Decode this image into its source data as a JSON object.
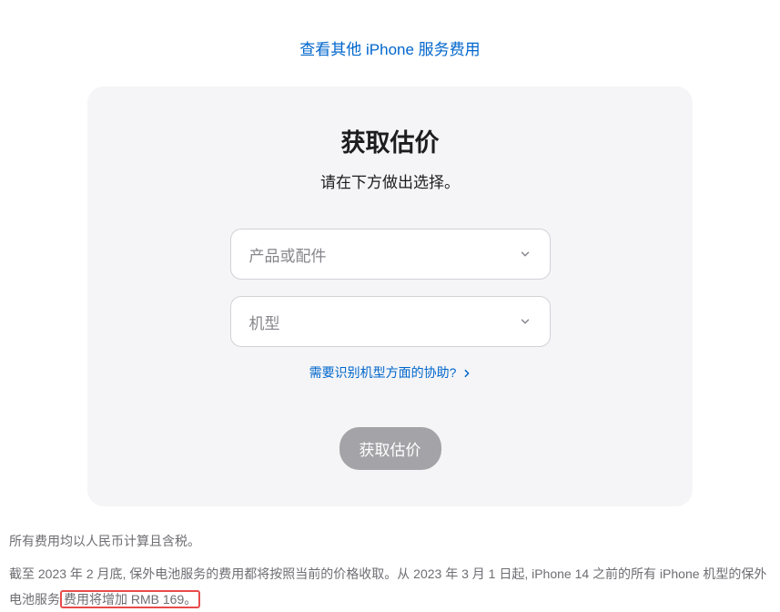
{
  "topLink": {
    "label": "查看其他 iPhone 服务费用"
  },
  "card": {
    "title": "获取估价",
    "subtitle": "请在下方做出选择。",
    "select1": {
      "placeholder": "产品或配件"
    },
    "select2": {
      "placeholder": "机型"
    },
    "helpLink": {
      "label": "需要识别机型方面的协助?"
    },
    "submit": {
      "label": "获取估价"
    }
  },
  "footer": {
    "line1": "所有费用均以人民币计算且含税。",
    "line2_pre": "截至 2023 年 2 月底, 保外电池服务的费用都将按照当前的价格收取。从 2023 年 3 月 1 日起, iPhone 14 之前的所有 iPhone 机型的保外电池服务",
    "line2_highlight": "费用将增加 RMB 169。"
  }
}
